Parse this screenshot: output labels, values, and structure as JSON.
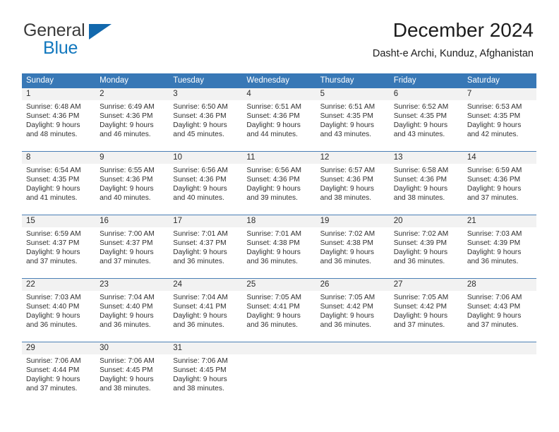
{
  "logo": {
    "text_top": "General",
    "text_bottom": "Blue",
    "triangle_icon": "triangle-icon",
    "color_dark": "#3b3b3b",
    "color_blue": "#1278be"
  },
  "header": {
    "title": "December 2024",
    "subtitle": "Dasht-e Archi, Kunduz, Afghanistan"
  },
  "colors": {
    "header_band": "#3878b6",
    "daynum_band": "#f2f2f2",
    "row_divider": "#4a7fb5",
    "text": "#303030"
  },
  "weekdays": [
    "Sunday",
    "Monday",
    "Tuesday",
    "Wednesday",
    "Thursday",
    "Friday",
    "Saturday"
  ],
  "weeks": [
    {
      "days": [
        {
          "num": "1",
          "sunrise": "Sunrise: 6:48 AM",
          "sunset": "Sunset: 4:36 PM",
          "daylight1": "Daylight: 9 hours",
          "daylight2": "and 48 minutes."
        },
        {
          "num": "2",
          "sunrise": "Sunrise: 6:49 AM",
          "sunset": "Sunset: 4:36 PM",
          "daylight1": "Daylight: 9 hours",
          "daylight2": "and 46 minutes."
        },
        {
          "num": "3",
          "sunrise": "Sunrise: 6:50 AM",
          "sunset": "Sunset: 4:36 PM",
          "daylight1": "Daylight: 9 hours",
          "daylight2": "and 45 minutes."
        },
        {
          "num": "4",
          "sunrise": "Sunrise: 6:51 AM",
          "sunset": "Sunset: 4:36 PM",
          "daylight1": "Daylight: 9 hours",
          "daylight2": "and 44 minutes."
        },
        {
          "num": "5",
          "sunrise": "Sunrise: 6:51 AM",
          "sunset": "Sunset: 4:35 PM",
          "daylight1": "Daylight: 9 hours",
          "daylight2": "and 43 minutes."
        },
        {
          "num": "6",
          "sunrise": "Sunrise: 6:52 AM",
          "sunset": "Sunset: 4:35 PM",
          "daylight1": "Daylight: 9 hours",
          "daylight2": "and 43 minutes."
        },
        {
          "num": "7",
          "sunrise": "Sunrise: 6:53 AM",
          "sunset": "Sunset: 4:35 PM",
          "daylight1": "Daylight: 9 hours",
          "daylight2": "and 42 minutes."
        }
      ]
    },
    {
      "days": [
        {
          "num": "8",
          "sunrise": "Sunrise: 6:54 AM",
          "sunset": "Sunset: 4:35 PM",
          "daylight1": "Daylight: 9 hours",
          "daylight2": "and 41 minutes."
        },
        {
          "num": "9",
          "sunrise": "Sunrise: 6:55 AM",
          "sunset": "Sunset: 4:36 PM",
          "daylight1": "Daylight: 9 hours",
          "daylight2": "and 40 minutes."
        },
        {
          "num": "10",
          "sunrise": "Sunrise: 6:56 AM",
          "sunset": "Sunset: 4:36 PM",
          "daylight1": "Daylight: 9 hours",
          "daylight2": "and 40 minutes."
        },
        {
          "num": "11",
          "sunrise": "Sunrise: 6:56 AM",
          "sunset": "Sunset: 4:36 PM",
          "daylight1": "Daylight: 9 hours",
          "daylight2": "and 39 minutes."
        },
        {
          "num": "12",
          "sunrise": "Sunrise: 6:57 AM",
          "sunset": "Sunset: 4:36 PM",
          "daylight1": "Daylight: 9 hours",
          "daylight2": "and 38 minutes."
        },
        {
          "num": "13",
          "sunrise": "Sunrise: 6:58 AM",
          "sunset": "Sunset: 4:36 PM",
          "daylight1": "Daylight: 9 hours",
          "daylight2": "and 38 minutes."
        },
        {
          "num": "14",
          "sunrise": "Sunrise: 6:59 AM",
          "sunset": "Sunset: 4:36 PM",
          "daylight1": "Daylight: 9 hours",
          "daylight2": "and 37 minutes."
        }
      ]
    },
    {
      "days": [
        {
          "num": "15",
          "sunrise": "Sunrise: 6:59 AM",
          "sunset": "Sunset: 4:37 PM",
          "daylight1": "Daylight: 9 hours",
          "daylight2": "and 37 minutes."
        },
        {
          "num": "16",
          "sunrise": "Sunrise: 7:00 AM",
          "sunset": "Sunset: 4:37 PM",
          "daylight1": "Daylight: 9 hours",
          "daylight2": "and 37 minutes."
        },
        {
          "num": "17",
          "sunrise": "Sunrise: 7:01 AM",
          "sunset": "Sunset: 4:37 PM",
          "daylight1": "Daylight: 9 hours",
          "daylight2": "and 36 minutes."
        },
        {
          "num": "18",
          "sunrise": "Sunrise: 7:01 AM",
          "sunset": "Sunset: 4:38 PM",
          "daylight1": "Daylight: 9 hours",
          "daylight2": "and 36 minutes."
        },
        {
          "num": "19",
          "sunrise": "Sunrise: 7:02 AM",
          "sunset": "Sunset: 4:38 PM",
          "daylight1": "Daylight: 9 hours",
          "daylight2": "and 36 minutes."
        },
        {
          "num": "20",
          "sunrise": "Sunrise: 7:02 AM",
          "sunset": "Sunset: 4:39 PM",
          "daylight1": "Daylight: 9 hours",
          "daylight2": "and 36 minutes."
        },
        {
          "num": "21",
          "sunrise": "Sunrise: 7:03 AM",
          "sunset": "Sunset: 4:39 PM",
          "daylight1": "Daylight: 9 hours",
          "daylight2": "and 36 minutes."
        }
      ]
    },
    {
      "days": [
        {
          "num": "22",
          "sunrise": "Sunrise: 7:03 AM",
          "sunset": "Sunset: 4:40 PM",
          "daylight1": "Daylight: 9 hours",
          "daylight2": "and 36 minutes."
        },
        {
          "num": "23",
          "sunrise": "Sunrise: 7:04 AM",
          "sunset": "Sunset: 4:40 PM",
          "daylight1": "Daylight: 9 hours",
          "daylight2": "and 36 minutes."
        },
        {
          "num": "24",
          "sunrise": "Sunrise: 7:04 AM",
          "sunset": "Sunset: 4:41 PM",
          "daylight1": "Daylight: 9 hours",
          "daylight2": "and 36 minutes."
        },
        {
          "num": "25",
          "sunrise": "Sunrise: 7:05 AM",
          "sunset": "Sunset: 4:41 PM",
          "daylight1": "Daylight: 9 hours",
          "daylight2": "and 36 minutes."
        },
        {
          "num": "26",
          "sunrise": "Sunrise: 7:05 AM",
          "sunset": "Sunset: 4:42 PM",
          "daylight1": "Daylight: 9 hours",
          "daylight2": "and 36 minutes."
        },
        {
          "num": "27",
          "sunrise": "Sunrise: 7:05 AM",
          "sunset": "Sunset: 4:42 PM",
          "daylight1": "Daylight: 9 hours",
          "daylight2": "and 37 minutes."
        },
        {
          "num": "28",
          "sunrise": "Sunrise: 7:06 AM",
          "sunset": "Sunset: 4:43 PM",
          "daylight1": "Daylight: 9 hours",
          "daylight2": "and 37 minutes."
        }
      ]
    },
    {
      "days": [
        {
          "num": "29",
          "sunrise": "Sunrise: 7:06 AM",
          "sunset": "Sunset: 4:44 PM",
          "daylight1": "Daylight: 9 hours",
          "daylight2": "and 37 minutes."
        },
        {
          "num": "30",
          "sunrise": "Sunrise: 7:06 AM",
          "sunset": "Sunset: 4:45 PM",
          "daylight1": "Daylight: 9 hours",
          "daylight2": "and 38 minutes."
        },
        {
          "num": "31",
          "sunrise": "Sunrise: 7:06 AM",
          "sunset": "Sunset: 4:45 PM",
          "daylight1": "Daylight: 9 hours",
          "daylight2": "and 38 minutes."
        },
        {
          "num": "",
          "sunrise": "",
          "sunset": "",
          "daylight1": "",
          "daylight2": ""
        },
        {
          "num": "",
          "sunrise": "",
          "sunset": "",
          "daylight1": "",
          "daylight2": ""
        },
        {
          "num": "",
          "sunrise": "",
          "sunset": "",
          "daylight1": "",
          "daylight2": ""
        },
        {
          "num": "",
          "sunrise": "",
          "sunset": "",
          "daylight1": "",
          "daylight2": ""
        }
      ]
    }
  ]
}
